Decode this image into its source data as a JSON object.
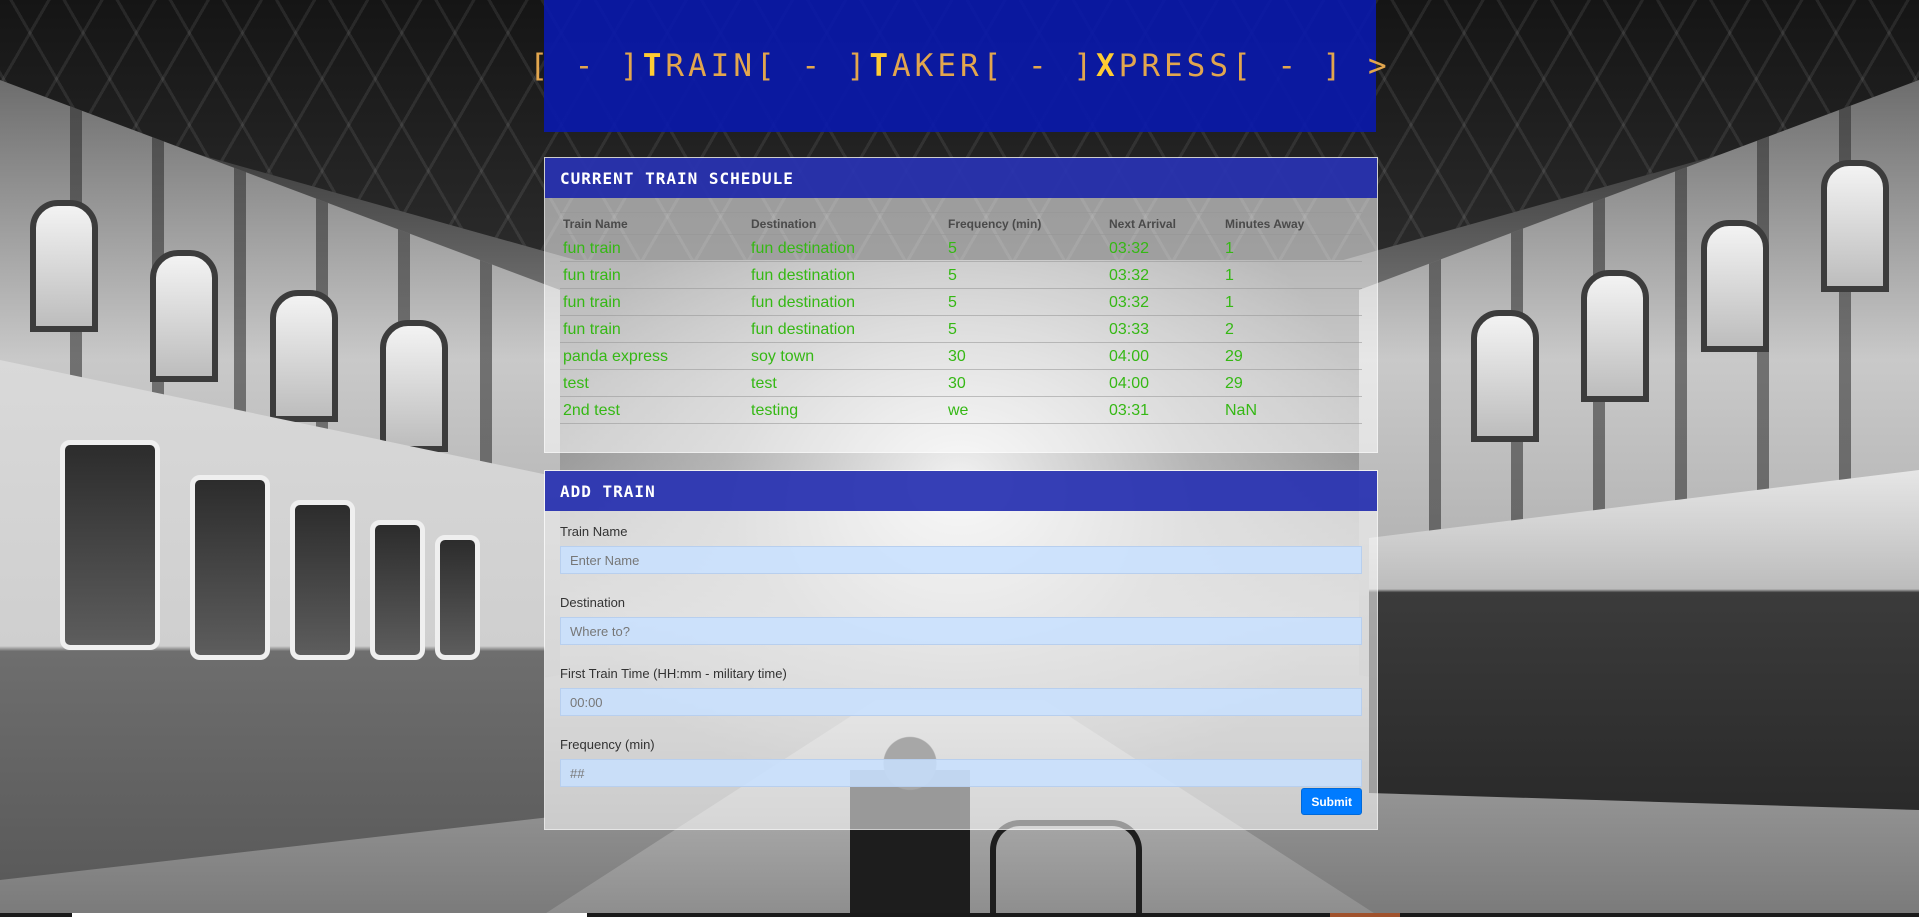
{
  "header": {
    "title_parts": [
      {
        "text": "[ - ]",
        "cap": false
      },
      {
        "text": "T",
        "cap": true
      },
      {
        "text": "RAIN",
        "cap": false
      },
      {
        "text": "[ - ]",
        "cap": false
      },
      {
        "text": "T",
        "cap": true
      },
      {
        "text": "AKER",
        "cap": false
      },
      {
        "text": "[ - ]",
        "cap": false
      },
      {
        "text": "X",
        "cap": true
      },
      {
        "text": "PRESS",
        "cap": false
      },
      {
        "text": "[ - ] >",
        "cap": false
      }
    ]
  },
  "schedule": {
    "title": "Current Train Schedule",
    "columns": [
      "Train Name",
      "Destination",
      "Frequency (min)",
      "Next Arrival",
      "Minutes Away"
    ],
    "rows": [
      [
        "fun train",
        "fun destination",
        "5",
        "03:32",
        "1"
      ],
      [
        "fun train",
        "fun destination",
        "5",
        "03:32",
        "1"
      ],
      [
        "fun train",
        "fun destination",
        "5",
        "03:32",
        "1"
      ],
      [
        "fun train",
        "fun destination",
        "5",
        "03:33",
        "2"
      ],
      [
        "panda express",
        "soy town",
        "30",
        "04:00",
        "29"
      ],
      [
        "test",
        "test",
        "30",
        "04:00",
        "29"
      ],
      [
        "2nd test",
        "testing",
        "we",
        "03:31",
        "NaN"
      ]
    ]
  },
  "add_train": {
    "title": "Add Train",
    "fields": [
      {
        "name": "train-name-input",
        "label": "Train Name",
        "placeholder": "Enter Name",
        "value": ""
      },
      {
        "name": "destination-input",
        "label": "Destination",
        "placeholder": "Where to?",
        "value": ""
      },
      {
        "name": "first-train-time-input",
        "label": "First Train Time (HH:mm - military time)",
        "placeholder": "00:00",
        "value": ""
      },
      {
        "name": "frequency-input",
        "label": "Frequency (min)",
        "placeholder": "##",
        "value": ""
      }
    ],
    "submit_label": "Submit"
  },
  "colors": {
    "header_bg": "#0a19aa",
    "title_text": "#e2a64e",
    "table_text": "#35b814",
    "submit_bg": "#007bff"
  }
}
